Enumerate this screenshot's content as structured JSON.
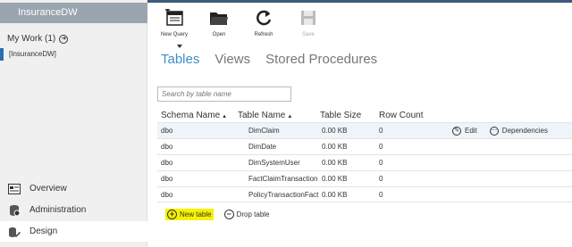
{
  "sidebar": {
    "database_header": "InsuranceDW",
    "my_work_label": "My Work (1)",
    "database_item": "[InsuranceDW]",
    "nav": [
      {
        "label": "Overview",
        "icon": "overview-icon"
      },
      {
        "label": "Administration",
        "icon": "database-icon"
      },
      {
        "label": "Design",
        "icon": "design-icon"
      }
    ]
  },
  "toolbar": {
    "buttons": [
      {
        "label": "New Query",
        "icon": "new-query-icon"
      },
      {
        "label": "Open",
        "icon": "folder-icon"
      },
      {
        "label": "Refresh",
        "icon": "refresh-icon"
      },
      {
        "label": "Save",
        "icon": "save-icon",
        "disabled": true
      }
    ]
  },
  "tabs": [
    "Tables",
    "Views",
    "Stored Procedures"
  ],
  "search": {
    "placeholder": "Search by table name"
  },
  "table": {
    "headers": {
      "schema": "Schema Name",
      "name": "Table Name",
      "size": "Table Size",
      "count": "Row Count"
    },
    "rows": [
      {
        "schema": "dbo",
        "name": "DimClaim",
        "size": "0.00 KB",
        "count": "0"
      },
      {
        "schema": "dbo",
        "name": "DimDate",
        "size": "0.00 KB",
        "count": "0"
      },
      {
        "schema": "dbo",
        "name": "DimSystemUser",
        "size": "0.00 KB",
        "count": "0"
      },
      {
        "schema": "dbo",
        "name": "FactClaimTransaction",
        "size": "0.00 KB",
        "count": "0"
      },
      {
        "schema": "dbo",
        "name": "PolicyTransactionFact",
        "size": "0.00 KB",
        "count": "0"
      }
    ],
    "row_actions": {
      "edit": "Edit",
      "dependencies": "Dependencies"
    }
  },
  "bottom_actions": {
    "new_table": "New table",
    "drop_table": "Drop table"
  },
  "colors": {
    "accent": "#3d8fc6",
    "highlight": "#f7f200",
    "sidebar_header": "#9aa5b0"
  }
}
